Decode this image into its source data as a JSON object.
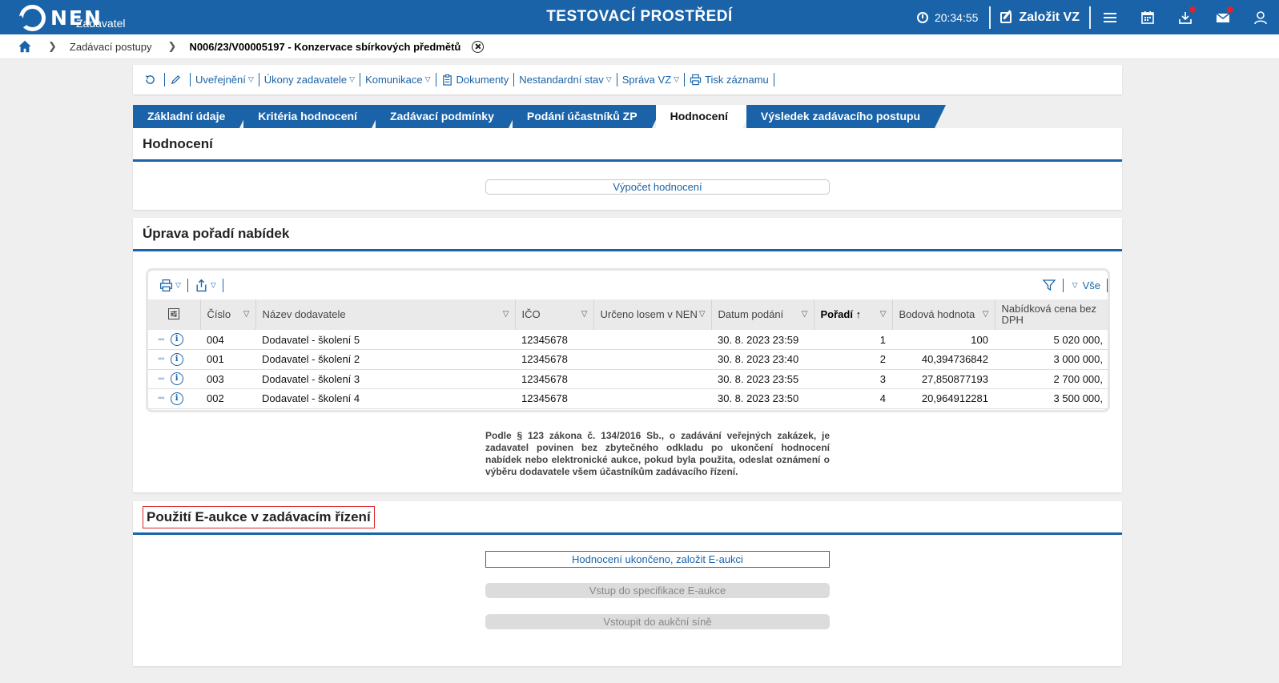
{
  "header": {
    "logo_text": "NEN",
    "logo_sub": "Zadavatel",
    "env_title": "TESTOVACÍ PROSTŘEDÍ",
    "clock": "20:34:55",
    "create_label": "Založit VZ",
    "icons": [
      "menu-icon",
      "calendar-icon",
      "download-icon",
      "mail-icon",
      "user-icon"
    ]
  },
  "breadcrumb": {
    "items": [
      "Zadávací postupy",
      "N006/23/V00005197 - Konzervace sbírkových předmětů"
    ]
  },
  "actionbar": {
    "items": [
      "Uveřejnění",
      "Úkony zadavatele",
      "Komunikace",
      "Dokumenty",
      "Nestandardní stav",
      "Správa VZ",
      "Tisk záznamu"
    ]
  },
  "tabs": [
    "Základní údaje",
    "Kritéria hodnocení",
    "Zadávací podmínky",
    "Podání účastníků ZP",
    "Hodnocení",
    "Výsledek zadávacího postupu"
  ],
  "active_tab": "Hodnocení",
  "panel_hodnoceni": {
    "title": "Hodnocení",
    "button": "Výpočet hodnocení"
  },
  "panel_poradi": {
    "title": "Úprava pořadí nabídek",
    "filter_all": "Vše",
    "columns": [
      "Číslo",
      "Název dodavatele",
      "IČO",
      "Určeno losem v NEN",
      "Datum podání",
      "Pořadí",
      "Bodová hodnota",
      "Nabídková cena bez DPH"
    ],
    "rows": [
      {
        "cislo": "004",
        "nazev": "Dodavatel - školení 5",
        "ico": "12345678",
        "los": "",
        "datum": "30. 8. 2023 23:59",
        "poradi": "1",
        "body": "100",
        "cena": "5 020 000,"
      },
      {
        "cislo": "001",
        "nazev": "Dodavatel - školení 2",
        "ico": "12345678",
        "los": "",
        "datum": "30. 8. 2023 23:40",
        "poradi": "2",
        "body": "40,394736842",
        "cena": "3 000 000,"
      },
      {
        "cislo": "003",
        "nazev": "Dodavatel - školení 3",
        "ico": "12345678",
        "los": "",
        "datum": "30. 8. 2023 23:55",
        "poradi": "3",
        "body": "27,850877193",
        "cena": "2 700 000,"
      },
      {
        "cislo": "002",
        "nazev": "Dodavatel - školení 4",
        "ico": "12345678",
        "los": "",
        "datum": "30. 8. 2023 23:50",
        "poradi": "4",
        "body": "20,964912281",
        "cena": "3 500 000,"
      }
    ],
    "note": "Podle § 123 zákona č. 134/2016 Sb., o zadávání veřejných zakázek, je zadavatel povinen bez zbytečného odkladu po ukončení hodnocení nabídek nebo elektronické aukce, pokud byla použita, odeslat oznámení o výběru dodavatele všem účastníkům zadávacího řízení."
  },
  "panel_eaukce": {
    "title": "Použití E-aukce v zadávacím řízení",
    "btn_create": "Hodnocení ukončeno, založit E-aukci",
    "btn_spec": "Vstup do specifikace E-aukce",
    "btn_hall": "Vstoupit do aukční síně"
  },
  "colors": {
    "brand_blue": "#1a63a8",
    "highlight_red": "#d9262c",
    "notification_dot": "#d9262c"
  }
}
